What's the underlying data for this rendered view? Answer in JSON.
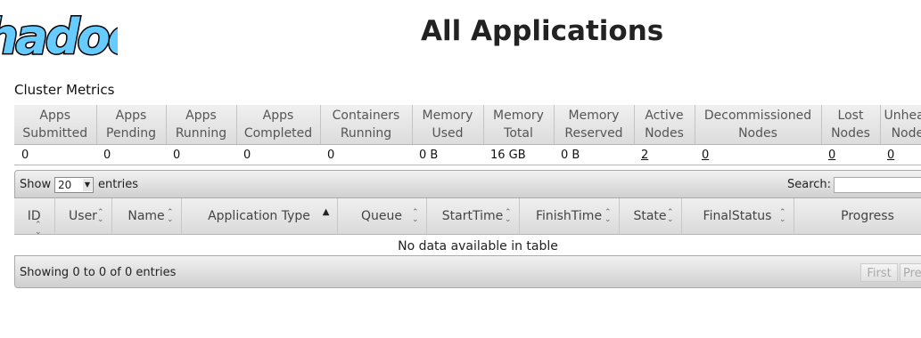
{
  "header": {
    "logo_text": "hadoop",
    "title": "All Applications"
  },
  "cluster_metrics": {
    "title": "Cluster Metrics",
    "headers": [
      [
        "Apps",
        "Submitted"
      ],
      [
        "Apps",
        "Pending"
      ],
      [
        "Apps",
        "Running"
      ],
      [
        "Apps",
        "Completed"
      ],
      [
        "Containers",
        "Running"
      ],
      [
        "Memory",
        "Used"
      ],
      [
        "Memory",
        "Total"
      ],
      [
        "Memory",
        "Reserved"
      ],
      [
        "Active",
        "Nodes"
      ],
      [
        "Decommissioned",
        "Nodes"
      ],
      [
        "Lost",
        "Nodes"
      ],
      [
        "Unhealthy",
        "Nodes"
      ]
    ],
    "values": [
      "0",
      "0",
      "0",
      "0",
      "0",
      "0 B",
      "16 GB",
      "0 B",
      "2",
      "0",
      "0",
      "0"
    ]
  },
  "table_controls": {
    "show_label": "Show",
    "page_length": "20",
    "entries_label": "entries",
    "search_label": "Search:"
  },
  "apps_table": {
    "headers": [
      "ID",
      "User",
      "Name",
      "Application Type",
      "Queue",
      "StartTime",
      "FinishTime",
      "State",
      "FinalStatus",
      "Progress"
    ],
    "empty_message": "No data available in table"
  },
  "footer": {
    "info": "Showing 0 to 0 of 0 entries",
    "first_label": "First",
    "previous_label": "Previous"
  },
  "colors": {
    "logo_fill": "#66ccff",
    "logo_outline": "#000000"
  },
  "icons": {
    "logo": "hadoop-logo",
    "sort": "sort-both-icon",
    "sort_asc": "sort-asc-icon"
  }
}
